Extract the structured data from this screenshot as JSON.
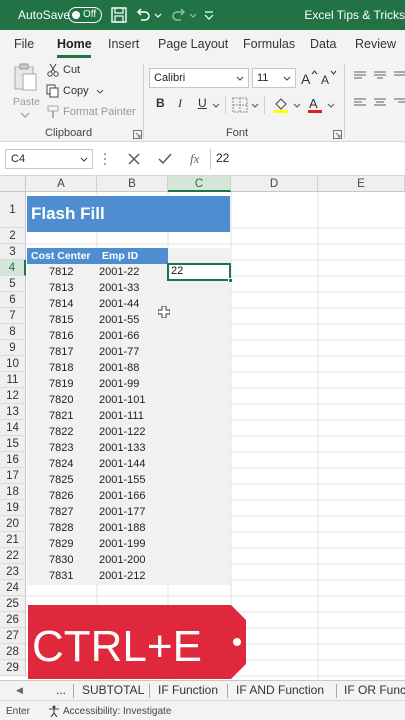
{
  "titlebar": {
    "autosave_label": "AutoSave",
    "autosave_state": "Off",
    "doc_title": "Excel Tips & Tricks",
    "accent": "#217346"
  },
  "ribbon_tabs": [
    "File",
    "Home",
    "Insert",
    "Page Layout",
    "Formulas",
    "Data",
    "Review"
  ],
  "active_tab": "Home",
  "clipboard": {
    "paste": "Paste",
    "cut": "Cut",
    "copy": "Copy",
    "format_painter": "Format Painter",
    "group_label": "Clipboard"
  },
  "font": {
    "name": "Calibri",
    "size": "11",
    "group_label": "Font",
    "bold": "B",
    "italic": "I",
    "underline": "U"
  },
  "formula_bar": {
    "name_box": "C4",
    "fx": "fx",
    "value": "22"
  },
  "columns": [
    "A",
    "B",
    "C",
    "D",
    "E"
  ],
  "selected_column": "C",
  "rows": [
    "1",
    "2",
    "3",
    "4",
    "5",
    "6",
    "7",
    "8",
    "9",
    "10",
    "11",
    "12",
    "13",
    "14",
    "15",
    "16",
    "17",
    "18",
    "19",
    "20",
    "21",
    "22",
    "23",
    "24",
    "25",
    "26",
    "27",
    "28",
    "29"
  ],
  "selected_row": "4",
  "sheet": {
    "title": "Flash Fill",
    "headers": [
      "Cost Center",
      "Emp ID"
    ],
    "records": [
      [
        "7812",
        "2001-22"
      ],
      [
        "7813",
        "2001-33"
      ],
      [
        "7814",
        "2001-44"
      ],
      [
        "7815",
        "2001-55"
      ],
      [
        "7816",
        "2001-66"
      ],
      [
        "7817",
        "2001-77"
      ],
      [
        "7818",
        "2001-88"
      ],
      [
        "7819",
        "2001-99"
      ],
      [
        "7820",
        "2001-101"
      ],
      [
        "7821",
        "2001-111"
      ],
      [
        "7822",
        "2001-122"
      ],
      [
        "7823",
        "2001-133"
      ],
      [
        "7824",
        "2001-144"
      ],
      [
        "7825",
        "2001-155"
      ],
      [
        "7826",
        "2001-166"
      ],
      [
        "7827",
        "2001-177"
      ],
      [
        "7828",
        "2001-188"
      ],
      [
        "7829",
        "2001-199"
      ],
      [
        "7830",
        "2001-200"
      ],
      [
        "7831",
        "2001-212"
      ]
    ],
    "active_cell_value": "22",
    "header_color": "#4e8ed0"
  },
  "callout": {
    "text": "CTRL+E",
    "color": "#e0283c"
  },
  "sheet_tabs": {
    "nav": "◀",
    "more": "...",
    "tabs": [
      "SUBTOTAL",
      "IF Function",
      "IF AND Function",
      "IF OR Func"
    ]
  },
  "status": {
    "mode": "Enter",
    "accessibility": "Accessibility: Investigate"
  }
}
